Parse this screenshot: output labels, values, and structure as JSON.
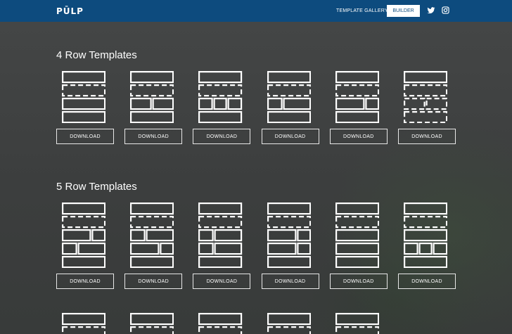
{
  "nav": {
    "logo": "PŪLP",
    "gallery_link": "TEMPLATE GALLERY",
    "builder_button": "BUILDER",
    "icons": [
      "twitter-icon",
      "instagram-icon"
    ]
  },
  "colors": {
    "nav_bg": "#0d4b7e",
    "page_bg": "#3f4242",
    "outline": "#ffffff"
  },
  "sections": [
    {
      "title": "4 Row Templates",
      "templates": [
        {
          "rows": [
            "s1",
            "d1",
            "s1",
            "s1"
          ],
          "button": "DOWNLOAD"
        },
        {
          "rows": [
            "s1",
            "d1",
            "s2",
            "s1"
          ],
          "button": "DOWNLOAD"
        },
        {
          "rows": [
            "s1",
            "d1",
            "s3",
            "s1"
          ],
          "button": "DOWNLOAD"
        },
        {
          "rows": [
            "s1",
            "d1",
            "s2b",
            "s1"
          ],
          "button": "DOWNLOAD"
        },
        {
          "rows": [
            "s1",
            "d1",
            "s2c",
            "s1"
          ],
          "button": "DOWNLOAD"
        },
        {
          "rows": [
            "s1",
            "d1",
            "d2",
            "d1"
          ],
          "button": "DOWNLOAD"
        }
      ]
    },
    {
      "title": "5 Row Templates",
      "templates": [
        {
          "rows": [
            "s1",
            "d1",
            "s2c",
            "s2b",
            "s1"
          ],
          "button": "DOWNLOAD"
        },
        {
          "rows": [
            "s1",
            "d1",
            "s2b",
            "s2c",
            "s1"
          ],
          "button": "DOWNLOAD"
        },
        {
          "rows": [
            "s1",
            "d1",
            "s2b",
            "s2b",
            "s1"
          ],
          "button": "DOWNLOAD"
        },
        {
          "rows": [
            "s1",
            "d1",
            "s2c",
            "s2c",
            "s1"
          ],
          "button": "DOWNLOAD"
        },
        {
          "rows": [
            "s1",
            "d1",
            "s1",
            "s1",
            "s1"
          ],
          "button": "DOWNLOAD"
        },
        {
          "rows": [
            "s1",
            "d1",
            "s1",
            "s3",
            "s1"
          ],
          "button": "DOWNLOAD"
        }
      ]
    },
    {
      "title": "",
      "templates": [
        {
          "rows": [
            "s1",
            "d1"
          ],
          "button": ""
        },
        {
          "rows": [
            "s1",
            "d1"
          ],
          "button": ""
        },
        {
          "rows": [
            "s1",
            "d1"
          ],
          "button": ""
        },
        {
          "rows": [
            "s1",
            "d1"
          ],
          "button": ""
        },
        {
          "rows": [
            "s1",
            "d1"
          ],
          "button": ""
        }
      ]
    }
  ]
}
